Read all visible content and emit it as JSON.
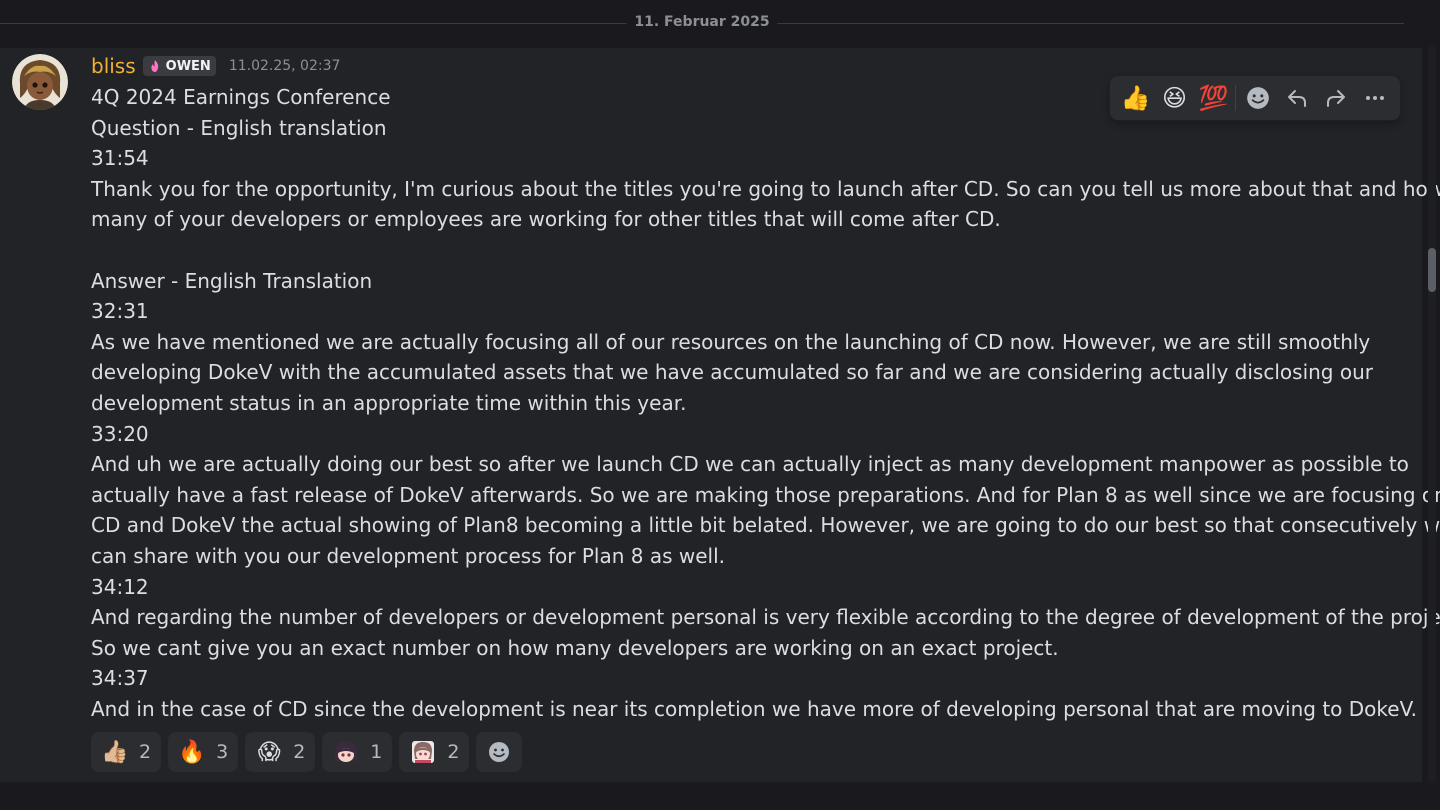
{
  "date_divider": "11. Februar 2025",
  "message": {
    "username": "bliss",
    "role_tag": "OWEN",
    "timestamp": "11.02.25, 02:37",
    "lines": [
      "4Q 2024 Earnings Conference",
      "Question - English translation",
      "31:54",
      "Thank you for the opportunity, I'm curious about the titles you're going to launch after CD. So can you tell us more about that and how",
      "many of your developers or employees are working for other titles that will come after CD.",
      "",
      "Answer - English Translation",
      "32:31",
      "As we have mentioned we are actually focusing all of our resources on the launching of CD now. However, we are still smoothly",
      "developing DokeV with the accumulated assets that we have accumulated so far and we are considering actually disclosing our",
      "development status in an appropriate time within this year.",
      "33:20",
      "And uh we are actually doing our best so after we launch CD we can actually inject as many development manpower as possible to",
      "actually have a fast release of DokeV afterwards. So we are making those preparations. And for Plan 8 as well since we are focusing on",
      "CD and DokeV the actual showing of Plan8 becoming a little bit belated. However, we are going to do our best so that consecutively we",
      "can share with you our development process for Plan 8 as well.",
      "34:12",
      "And regarding the number of developers or development personal is very flexible according to the degree of development of the project.",
      "So we cant give you an exact number on how many developers are working on an exact project.",
      "34:37",
      "And in the case of CD since the development is near its completion we have more of developing personal that are moving to DokeV."
    ],
    "reactions": [
      {
        "icon": "thumbs-up-medium-skin-icon",
        "glyph": "👍🏼",
        "count": "2"
      },
      {
        "icon": "fire-icon",
        "glyph": "🔥",
        "count": "3"
      },
      {
        "icon": "screaming-face-icon",
        "glyph": "😱",
        "count": "2"
      },
      {
        "icon": "custom-anime-girl-emoji-icon",
        "glyph": "",
        "count": "1"
      },
      {
        "icon": "custom-anime-girl-emoji-icon-2",
        "glyph": "",
        "count": "2"
      }
    ]
  },
  "toolbar": {
    "quick_reactions": [
      "👍",
      "😆",
      "💯"
    ],
    "add_reaction_icon": "add-reaction-icon",
    "reply_icon": "reply-icon",
    "forward_icon": "forward-icon",
    "more_icon": "more-options-icon"
  },
  "colors": {
    "background": "#1a1a1e",
    "message_hover": "#222327",
    "username": "#f0b232",
    "text": "#dbdee1",
    "muted": "#8d8f96"
  }
}
